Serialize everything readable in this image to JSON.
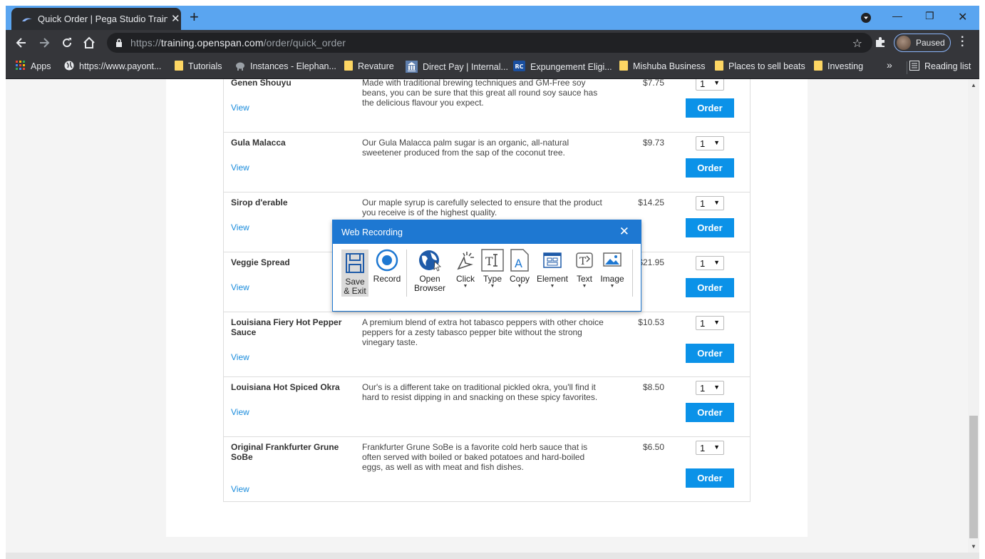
{
  "browser": {
    "tab_title": "Quick Order | Pega Studio Trainin",
    "new_tab_symbol": "+",
    "url_scheme": "https://",
    "url_domain": "training.openspan.com",
    "url_path": "/order/quick_order",
    "profile_label": "Paused",
    "bookmarks": [
      {
        "label": "Apps",
        "icon": "apps-grid-icon"
      },
      {
        "label": "https://www.payont...",
        "icon": "globe-icon"
      },
      {
        "label": "Tutorials",
        "icon": "folder-icon"
      },
      {
        "label": "Instances - Elephan...",
        "icon": "elephant-icon"
      },
      {
        "label": "Revature",
        "icon": "folder-icon"
      },
      {
        "label": "Direct Pay | Internal...",
        "icon": "bank-icon"
      },
      {
        "label": "Expungement Eligi...",
        "icon": "rc-icon"
      },
      {
        "label": "Mishuba Business",
        "icon": "folder-icon"
      },
      {
        "label": "Places to sell beats",
        "icon": "folder-icon"
      },
      {
        "label": "Investing",
        "icon": "folder-icon"
      }
    ],
    "more_bookmarks": "»",
    "reading_list": "Reading list"
  },
  "products": [
    {
      "name": "Genen Shouyu",
      "desc": "Made with traditional brewing techniques and GM-Free soy beans, you can be sure that this great all round soy sauce has the delicious flavour you expect.",
      "price": "$7.75",
      "qty": "1",
      "view": "View",
      "order": "Order"
    },
    {
      "name": "Gula Malacca",
      "desc": "Our Gula Malacca palm sugar is an organic, all-natural sweetener produced from the sap of the coconut tree.",
      "price": "$9.73",
      "qty": "1",
      "view": "View",
      "order": "Order"
    },
    {
      "name": "Sirop d'erable",
      "desc": "Our maple syrup is carefully selected to ensure that the product you receive is of the highest quality.",
      "price": "$14.25",
      "qty": "1",
      "view": "View",
      "order": "Order"
    },
    {
      "name": "Veggie Spread",
      "desc": "",
      "price": "$21.95",
      "qty": "1",
      "view": "View",
      "order": "Order"
    },
    {
      "name": "Louisiana Fiery Hot Pepper Sauce",
      "desc": "A premium blend of extra hot tabasco peppers with other choice peppers for a zesty tabasco pepper bite without the strong vinegary taste.",
      "price": "$10.53",
      "qty": "1",
      "view": "View",
      "order": "Order"
    },
    {
      "name": "Louisiana Hot Spiced Okra",
      "desc": "Our's is a different take on traditional pickled okra, you'll find it hard to resist dipping in and snacking on these spicy favorites.",
      "price": "$8.50",
      "qty": "1",
      "view": "View",
      "order": "Order"
    },
    {
      "name": "Original Frankfurter Grune SoBe",
      "desc": "Frankfurter Grune SoBe is a favorite cold herb sauce that is often served with boiled or baked potatoes and hard-boiled eggs, as well as with meat and fish dishes.",
      "price": "$6.50",
      "qty": "1",
      "view": "View",
      "order": "Order"
    }
  ],
  "dialog": {
    "title": "Web Recording",
    "tools": {
      "save_exit": "Save & Exit",
      "record": "Record",
      "open_browser": "Open Browser",
      "click": "Click",
      "type": "Type",
      "copy": "Copy",
      "element": "Element",
      "text": "Text",
      "image": "Image"
    }
  },
  "colors": {
    "tabbar": "#5aa5f0",
    "chrome_dark": "#35363a",
    "accent_blue": "#1e78d2",
    "order_button": "#0b92e8",
    "link": "#1a8cdc"
  }
}
